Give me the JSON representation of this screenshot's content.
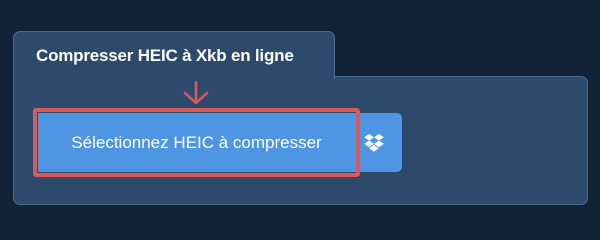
{
  "converter": {
    "tab_title": "Compresser HEIC à Xkb en ligne",
    "select_button_label": "Sélectionnez HEIC à compresser",
    "dropbox_icon": "dropbox-icon",
    "arrow_icon": "arrow-down-icon"
  },
  "colors": {
    "page_background": "#132337",
    "panel_background": "#2d4a6c",
    "button_background": "#4e96e4",
    "highlight_border": "#d95a5b"
  }
}
